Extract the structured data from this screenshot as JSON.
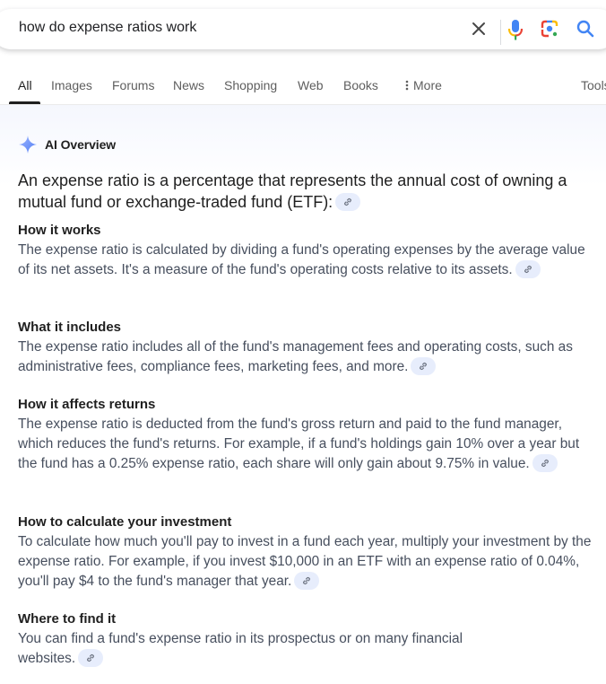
{
  "search": {
    "query": "how do expense ratios work",
    "clear_icon": "close-icon",
    "mic_icon": "microphone-icon",
    "lens_icon": "google-lens-icon",
    "search_icon": "search-icon"
  },
  "tabs": [
    {
      "label": "All",
      "active": true
    },
    {
      "label": "Images"
    },
    {
      "label": "Forums"
    },
    {
      "label": "News"
    },
    {
      "label": "Shopping"
    },
    {
      "label": "Web"
    },
    {
      "label": "Books"
    },
    {
      "label": "More",
      "icon": "more-vert-icon"
    },
    {
      "label": "Tools"
    }
  ],
  "ai_overview": {
    "title": "AI Overview",
    "icon": "sparkle-icon",
    "lead": "An expense ratio is a percentage that represents the annual cost of owning a mutual fund or exchange-traded fund (ETF):",
    "sections": [
      {
        "title": "How it works",
        "body": "The expense ratio is calculated by dividing a fund's operating expenses by the average value of its net assets. It's a measure of the fund's operating costs relative to its assets."
      },
      {
        "title": "What it includes",
        "body": "The expense ratio includes all of the fund's management fees and operating costs, such as administrative fees, compliance fees, marketing fees, and more."
      },
      {
        "title": "How it affects returns",
        "body": "The expense ratio is deducted from the fund's gross return and paid to the fund manager, which reduces the fund's returns. For example, if a fund's holdings gain 10% over a year but the fund has a 0.25% expense ratio, each share will only gain about 9.75% in value."
      },
      {
        "title": "How to calculate your investment",
        "body": "To calculate how much you'll pay to invest in a fund each year, multiply your investment by the expense ratio. For example, if you invest $10,000 in an ETF with an expense ratio of 0.04%, you'll pay $4 to the fund's manager that year."
      },
      {
        "title": "Where to find it",
        "body": "You can find a fund's expense ratio in its prospectus or on many financial websites."
      }
    ]
  },
  "colors": {
    "accent_blue": "#4285f4",
    "chip_bg": "#e7edfc",
    "body_text": "#474f5e"
  }
}
